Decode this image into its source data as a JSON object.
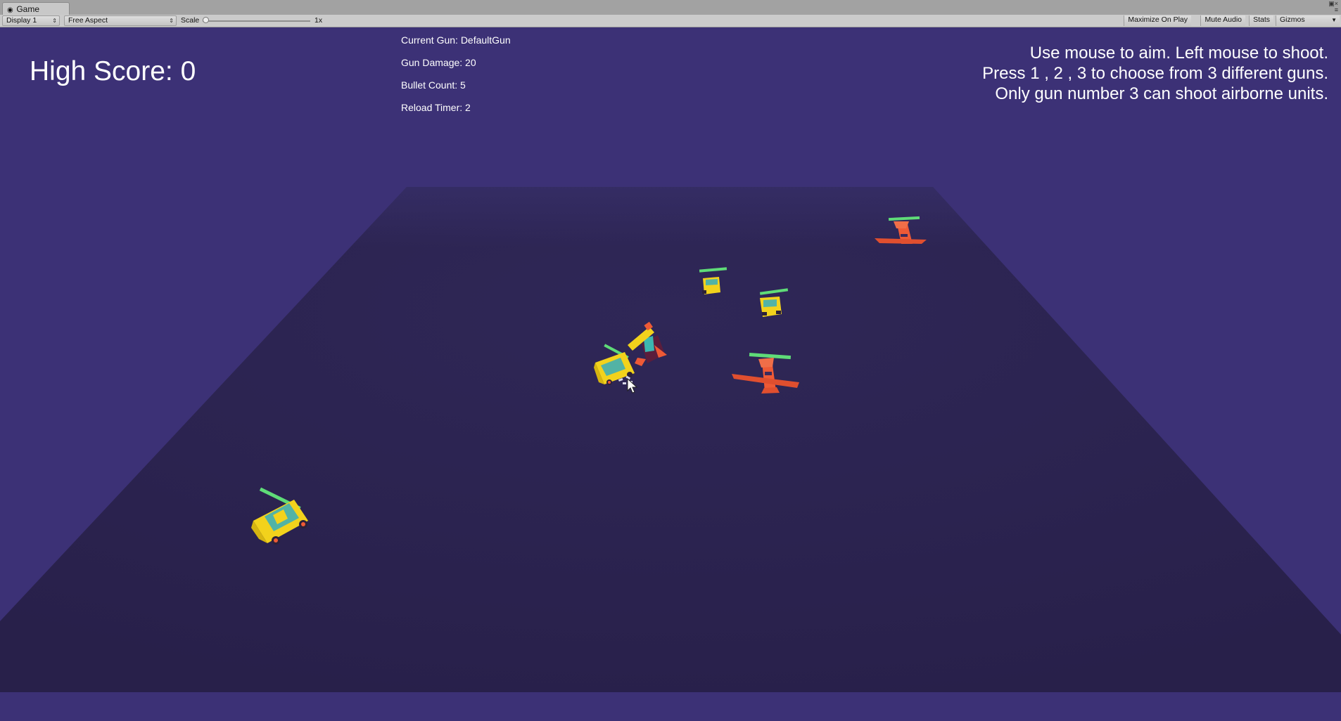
{
  "window": {
    "tab_title": "Game"
  },
  "toolbar": {
    "display_select": "Display 1",
    "aspect_select": "Free Aspect",
    "scale_label": "Scale",
    "scale_value": "1x",
    "scale_level": 0.0,
    "maximize_on_play": "Maximize On Play",
    "mute_audio": "Mute Audio",
    "stats": "Stats",
    "gizmos": "Gizmos"
  },
  "hud": {
    "high_score": "High Score: 0",
    "current_gun": "Current Gun: DefaultGun",
    "gun_damage": "Gun Damage: 20",
    "bullet_count": "Bullet Count: 5",
    "reload_timer": "Reload Timer: 2",
    "instructions": [
      "Use mouse to aim. Left mouse to shoot.",
      "Press 1 , 2 , 3 to choose from 3 different guns.",
      "Only gun number 3 can shoot airborne units."
    ]
  },
  "scene": {
    "colors": {
      "sky": "#3c3176",
      "ground": "#2b2350",
      "car_body": "#f2d21c",
      "car_window": "#52b3a5",
      "plane": "#ee5a36",
      "health_bar": "#5fdc78",
      "turret": "#5b1d3c"
    },
    "units": [
      {
        "name": "yellow-car",
        "kind": "ground"
      },
      {
        "name": "yellow-car",
        "kind": "ground"
      },
      {
        "name": "yellow-truck",
        "kind": "ground"
      },
      {
        "name": "yellow-truck",
        "kind": "ground"
      },
      {
        "name": "red-plane",
        "kind": "airborne"
      },
      {
        "name": "red-plane",
        "kind": "airborne"
      }
    ]
  }
}
